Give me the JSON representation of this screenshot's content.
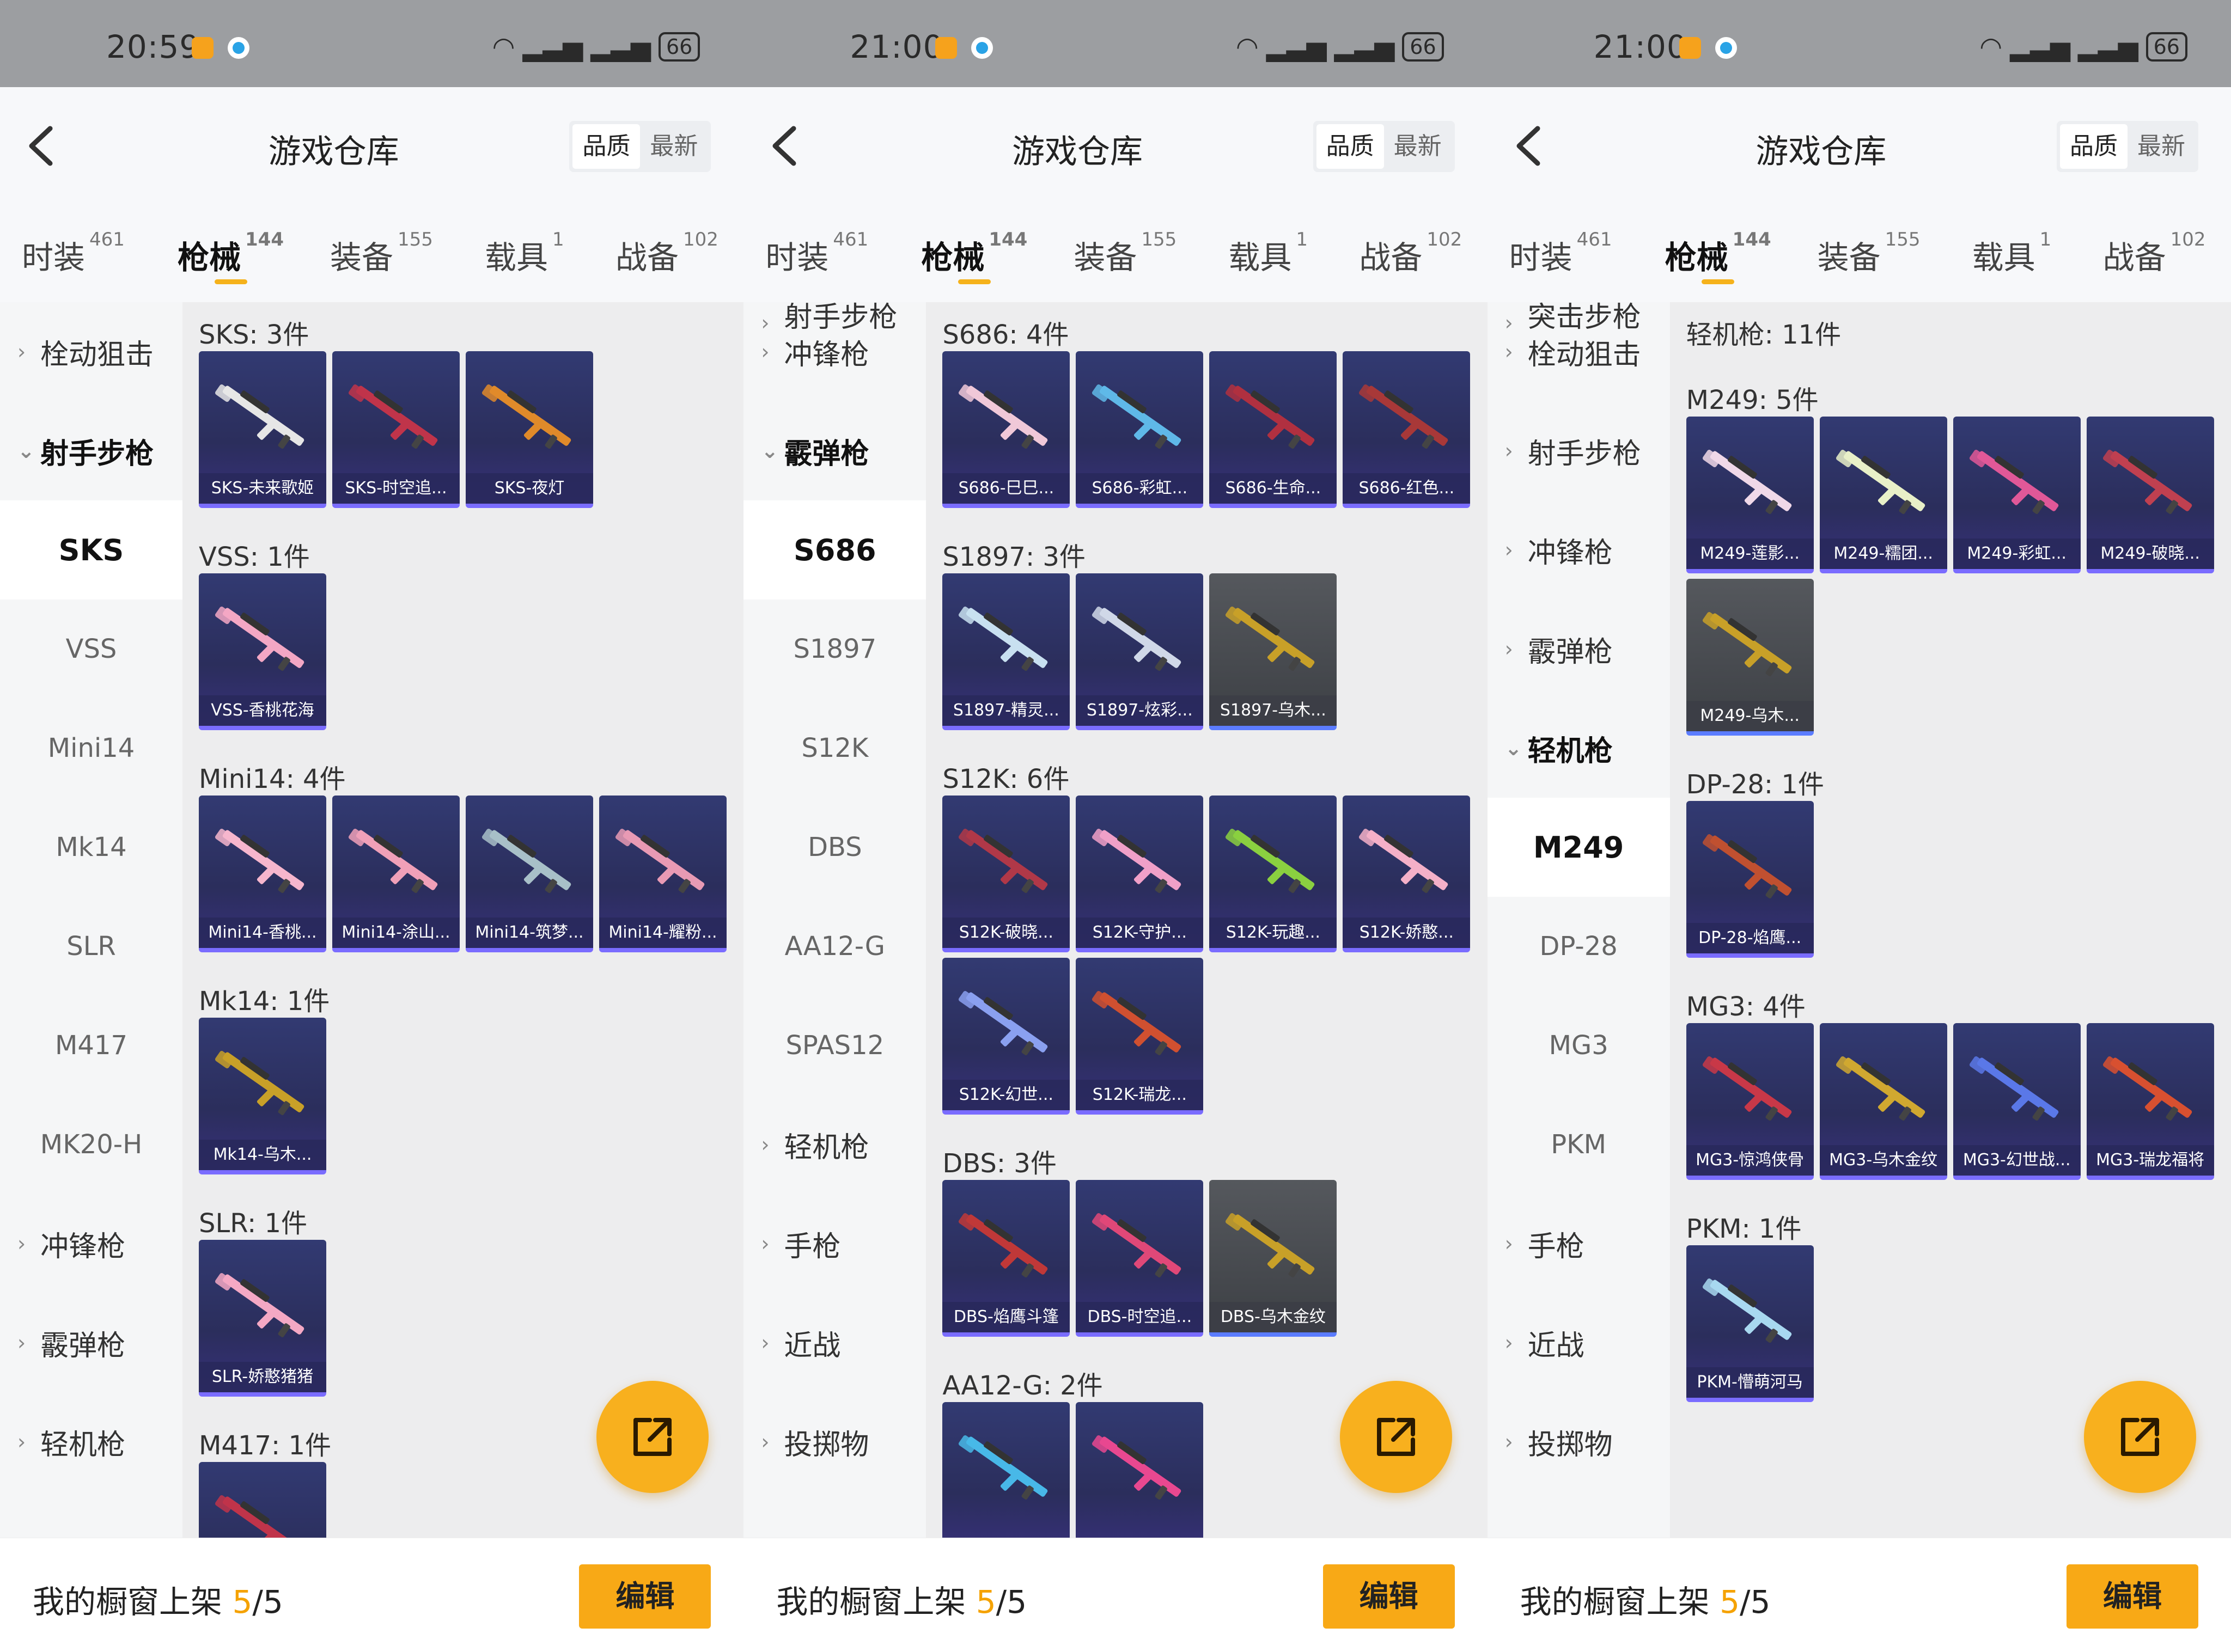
{
  "panels": [
    {
      "status": {
        "time": "20:59",
        "battery": "66"
      },
      "header": {
        "title": "游戏仓库",
        "sort": [
          "品质",
          "最新"
        ]
      },
      "tabs": [
        {
          "label": "时装",
          "count": "461"
        },
        {
          "label": "枪械",
          "count": "144"
        },
        {
          "label": "装备",
          "count": "155"
        },
        {
          "label": "载具",
          "count": "1"
        },
        {
          "label": "战备",
          "count": "102"
        }
      ],
      "sidebar": [
        {
          "label": "栓动狙击",
          "kind": "group",
          "open": false
        },
        {
          "label": "射手步枪",
          "kind": "group",
          "open": true
        },
        {
          "label": "SKS",
          "kind": "sub",
          "selected": true
        },
        {
          "label": "VSS",
          "kind": "sub"
        },
        {
          "label": "Mini14",
          "kind": "sub"
        },
        {
          "label": "Mk14",
          "kind": "sub"
        },
        {
          "label": "SLR",
          "kind": "sub"
        },
        {
          "label": "M417",
          "kind": "sub"
        },
        {
          "label": "MK20-H",
          "kind": "sub"
        },
        {
          "label": "冲锋枪",
          "kind": "group"
        },
        {
          "label": "霰弹枪",
          "kind": "group"
        },
        {
          "label": "轻机枪",
          "kind": "group"
        }
      ],
      "sections": [
        {
          "title": "SKS: 3件",
          "items": [
            {
              "name": "SKS-未来歌姬",
              "color": "#e6e6e6"
            },
            {
              "name": "SKS-时空追...",
              "color": "#c0344a"
            },
            {
              "name": "SKS-夜灯",
              "color": "#e08a2a"
            }
          ]
        },
        {
          "title": "VSS: 1件",
          "items": [
            {
              "name": "VSS-香桃花海",
              "color": "#f3a7c4"
            }
          ]
        },
        {
          "title": "Mini14: 4件",
          "items": [
            {
              "name": "Mini14-香桃...",
              "color": "#f6b6cd"
            },
            {
              "name": "Mini14-涂山...",
              "color": "#f0a0b8"
            },
            {
              "name": "Mini14-筑梦...",
              "color": "#a8c0c8"
            },
            {
              "name": "Mini14-耀粉...",
              "color": "#e89ab4"
            }
          ]
        },
        {
          "title": "Mk14: 1件",
          "items": [
            {
              "name": "Mk14-乌木...",
              "color": "#c8a028"
            }
          ]
        },
        {
          "title": "SLR: 1件",
          "items": [
            {
              "name": "SLR-娇憨猪猪",
              "color": "#f4a8c4"
            }
          ]
        },
        {
          "title": "M417: 1件",
          "items": [
            {
              "name": "",
              "color": "#c0344a"
            }
          ]
        }
      ],
      "footer": {
        "text": "我的橱窗上架 ",
        "count": "5",
        "total": "/5",
        "edit": "编辑"
      }
    },
    {
      "status": {
        "time": "21:00",
        "battery": "66"
      },
      "header": {
        "title": "游戏仓库",
        "sort": [
          "品质",
          "最新"
        ]
      },
      "tabs": [
        {
          "label": "时装",
          "count": "461"
        },
        {
          "label": "枪械",
          "count": "144"
        },
        {
          "label": "装备",
          "count": "155"
        },
        {
          "label": "载具",
          "count": "1"
        },
        {
          "label": "战备",
          "count": "102"
        }
      ],
      "sidebar": [
        {
          "label": "射手步枪",
          "kind": "group",
          "cut": true
        },
        {
          "label": "冲锋枪",
          "kind": "group"
        },
        {
          "label": "霰弹枪",
          "kind": "group",
          "open": true
        },
        {
          "label": "S686",
          "kind": "sub",
          "selected": true
        },
        {
          "label": "S1897",
          "kind": "sub"
        },
        {
          "label": "S12K",
          "kind": "sub"
        },
        {
          "label": "DBS",
          "kind": "sub"
        },
        {
          "label": "AA12-G",
          "kind": "sub"
        },
        {
          "label": "SPAS12",
          "kind": "sub"
        },
        {
          "label": "轻机枪",
          "kind": "group"
        },
        {
          "label": "手枪",
          "kind": "group"
        },
        {
          "label": "近战",
          "kind": "group"
        },
        {
          "label": "投掷物",
          "kind": "group"
        }
      ],
      "sections": [
        {
          "title": "S686: 4件",
          "items": [
            {
              "name": "S686-巳巳...",
              "color": "#f0c8d8"
            },
            {
              "name": "S686-彩虹...",
              "color": "#5fb8e8"
            },
            {
              "name": "S686-生命...",
              "color": "#b03040"
            },
            {
              "name": "S686-红色...",
              "color": "#a83838"
            }
          ]
        },
        {
          "title": "S1897: 3件",
          "items": [
            {
              "name": "S1897-精灵...",
              "color": "#c8e0f0"
            },
            {
              "name": "S1897-炫彩...",
              "color": "#d0d8e8"
            },
            {
              "name": "S1897-乌木...",
              "color": "#c8a028",
              "gray": true
            }
          ]
        },
        {
          "title": "S12K: 6件",
          "items": [
            {
              "name": "S12K-破晓...",
              "color": "#b03848"
            },
            {
              "name": "S12K-守护...",
              "color": "#f0a0c8"
            },
            {
              "name": "S12K-玩趣...",
              "color": "#8ad040"
            },
            {
              "name": "S12K-娇憨...",
              "color": "#f4b0c8"
            },
            {
              "name": "S12K-幻世...",
              "color": "#8aa0f0"
            },
            {
              "name": "S12K-瑞龙...",
              "color": "#d05030"
            }
          ]
        },
        {
          "title": "DBS: 3件",
          "items": [
            {
              "name": "DBS-焰鹰斗篷",
              "color": "#c03838"
            },
            {
              "name": "DBS-时空追...",
              "color": "#e04878"
            },
            {
              "name": "DBS-乌木金纹",
              "color": "#c8a028",
              "gray": true
            }
          ]
        },
        {
          "title": "AA12-G: 2件",
          "items": [
            {
              "name": "",
              "color": "#48b8e8"
            },
            {
              "name": "",
              "color": "#e84890"
            }
          ]
        }
      ],
      "footer": {
        "text": "我的橱窗上架 ",
        "count": "5",
        "total": "/5",
        "edit": "编辑"
      }
    },
    {
      "status": {
        "time": "21:00",
        "battery": "66"
      },
      "header": {
        "title": "游戏仓库",
        "sort": [
          "品质",
          "最新"
        ]
      },
      "tabs": [
        {
          "label": "时装",
          "count": "461"
        },
        {
          "label": "枪械",
          "count": "144"
        },
        {
          "label": "装备",
          "count": "155"
        },
        {
          "label": "载具",
          "count": "1"
        },
        {
          "label": "战备",
          "count": "102"
        }
      ],
      "sidebar": [
        {
          "label": "突击步枪",
          "kind": "group",
          "cut": true
        },
        {
          "label": "栓动狙击",
          "kind": "group"
        },
        {
          "label": "射手步枪",
          "kind": "group"
        },
        {
          "label": "冲锋枪",
          "kind": "group"
        },
        {
          "label": "霰弹枪",
          "kind": "group"
        },
        {
          "label": "轻机枪",
          "kind": "group",
          "open": true
        },
        {
          "label": "M249",
          "kind": "sub",
          "selected": true
        },
        {
          "label": "DP-28",
          "kind": "sub"
        },
        {
          "label": "MG3",
          "kind": "sub"
        },
        {
          "label": "PKM",
          "kind": "sub"
        },
        {
          "label": "手枪",
          "kind": "group"
        },
        {
          "label": "近战",
          "kind": "group"
        },
        {
          "label": "投掷物",
          "kind": "group"
        }
      ],
      "heading": "轻机枪: 11件",
      "sections": [
        {
          "title": "M249: 5件",
          "items": [
            {
              "name": "M249-莲影...",
              "color": "#f0d8e8"
            },
            {
              "name": "M249-糯团...",
              "color": "#e8f0c8"
            },
            {
              "name": "M249-彩虹...",
              "color": "#e05898"
            },
            {
              "name": "M249-破晓...",
              "color": "#c04050"
            },
            {
              "name": "M249-乌木...",
              "color": "#c8a028",
              "gray": true
            }
          ]
        },
        {
          "title": "DP-28: 1件",
          "items": [
            {
              "name": "DP-28-焰鹰...",
              "color": "#c05030"
            }
          ]
        },
        {
          "title": "MG3: 4件",
          "items": [
            {
              "name": "MG3-惊鸿侠骨",
              "color": "#c83848"
            },
            {
              "name": "MG3-乌木金纹",
              "color": "#d0a830"
            },
            {
              "name": "MG3-幻世战...",
              "color": "#5a78e8"
            },
            {
              "name": "MG3-瑞龙福将",
              "color": "#d85030"
            }
          ]
        },
        {
          "title": "PKM: 1件",
          "items": [
            {
              "name": "PKM-懵萌河马",
              "color": "#a8d8f0"
            }
          ]
        }
      ],
      "footer": {
        "text": "我的橱窗上架 ",
        "count": "5",
        "total": "/5",
        "edit": "编辑"
      }
    }
  ],
  "colors": {
    "accent": "#f8a916",
    "card_bg": "#2b2e5c",
    "card_border": "#7a6cff"
  },
  "icons": {
    "back": "chevron-left-icon",
    "fab": "external-link-icon",
    "chevron": "chevron-icon"
  }
}
